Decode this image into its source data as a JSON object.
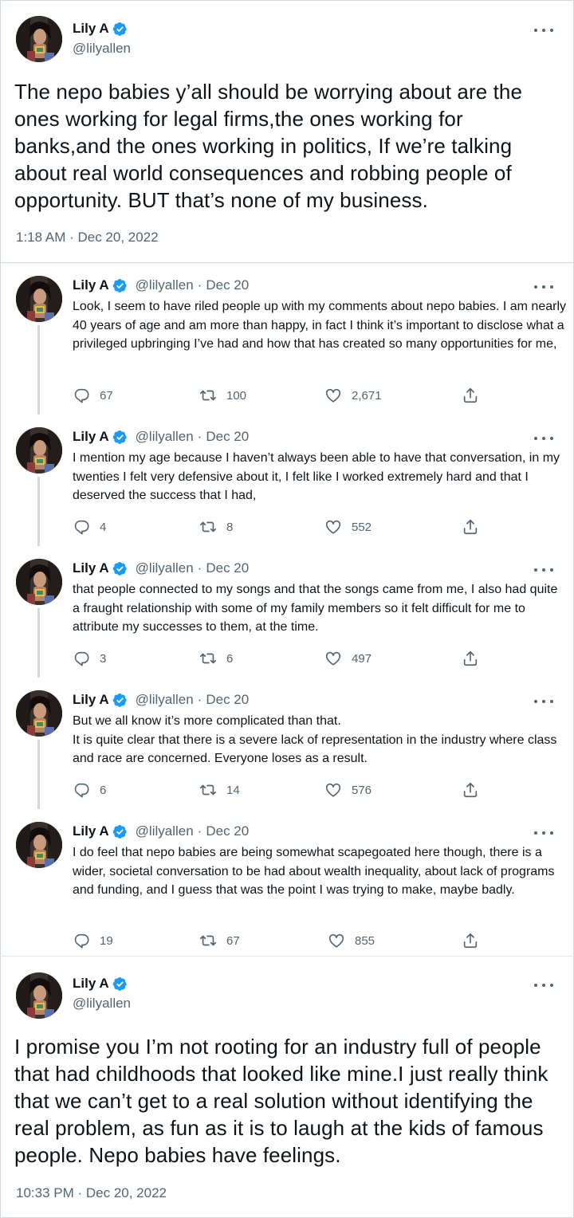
{
  "author": {
    "name": "Lily A",
    "handle": "@lilyallen",
    "verified_color": "#1d9bf0"
  },
  "main_tweet": {
    "text": "The nepo babies y’all should be worrying about are the ones working for legal firms,the ones working for banks,and the ones working in politics, If we’re talking about real world consequences and robbing people of opportunity. BUT that’s none of my business.",
    "timestamp": "1:18 AM · Dec 20, 2022"
  },
  "replies": [
    {
      "date": "Dec 20",
      "text": "Look, I seem to have riled people up with my comments about nepo babies. I am nearly 40 years of age and am more than happy, in fact I think it’s important to disclose what a privileged upbringing I’ve had and how that has created so many opportunities for me,",
      "replies": "67",
      "retweets": "100",
      "likes": "2,671"
    },
    {
      "date": "Dec 20",
      "text": "I mention my age because I haven’t always been able to have that conversation, in my twenties I felt very defensive about it, I felt like I worked extremely hard and that I deserved the success that I had,",
      "replies": "4",
      "retweets": "8",
      "likes": "552"
    },
    {
      "date": "Dec 20",
      "text": "that people connected to my songs and that the songs came from me, I also had quite a fraught relationship with some of my family members so it felt difficult for me to attribute my successes to them, at the time.",
      "replies": "3",
      "retweets": "6",
      "likes": "497"
    },
    {
      "date": "Dec 20",
      "text": "But we all know it’s more complicated than that.\nIt is quite clear that there is a severe lack of representation in the industry where class and race are concerned. Everyone loses as a result.",
      "replies": "6",
      "retweets": "14",
      "likes": "576"
    },
    {
      "date": "Dec 20",
      "text": "I do feel that nepo babies are being somewhat scapegoated here though, there is a wider, societal conversation to be had about wealth inequality, about lack of programs and funding, and I guess that was the point I was trying to make, maybe badly.",
      "replies": "19",
      "retweets": "67",
      "likes": "855"
    }
  ],
  "final_tweet": {
    "text": "I promise you I’m not rooting for an industry full of people that had childhoods that looked like mine.I just really think that we can’t get to a real solution without identifying the real problem, as fun as it is to laugh at the kids of famous people. Nepo babies have feelings.",
    "timestamp": "10:33 PM · Dec 20, 2022"
  },
  "icons": {
    "more": "more-options-icon",
    "verified": "verified-badge-icon",
    "reply": "reply-icon",
    "retweet": "retweet-icon",
    "like": "heart-icon",
    "share": "share-icon"
  }
}
